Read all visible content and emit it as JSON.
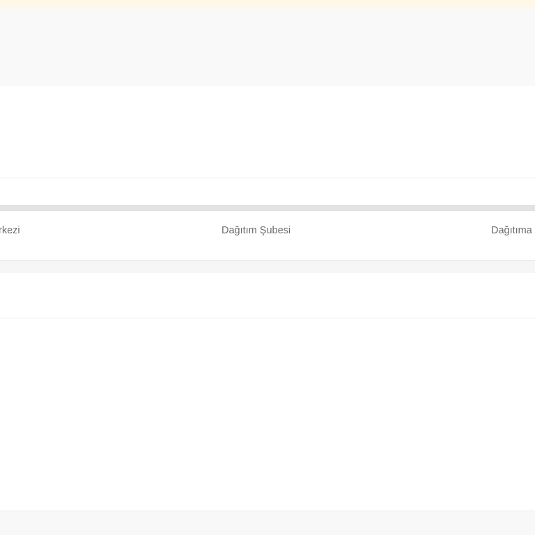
{
  "table": {
    "columns": [
      {
        "label": "rkezi"
      },
      {
        "label": "Dağıtım Şubesi"
      },
      {
        "label": "Dağıtıma"
      }
    ]
  },
  "colors": {
    "notice_bar": "#fff8e6",
    "top_band": "#f9f9f9",
    "header_rule": "#e3e3e5",
    "header_text": "#6b6b6b"
  }
}
